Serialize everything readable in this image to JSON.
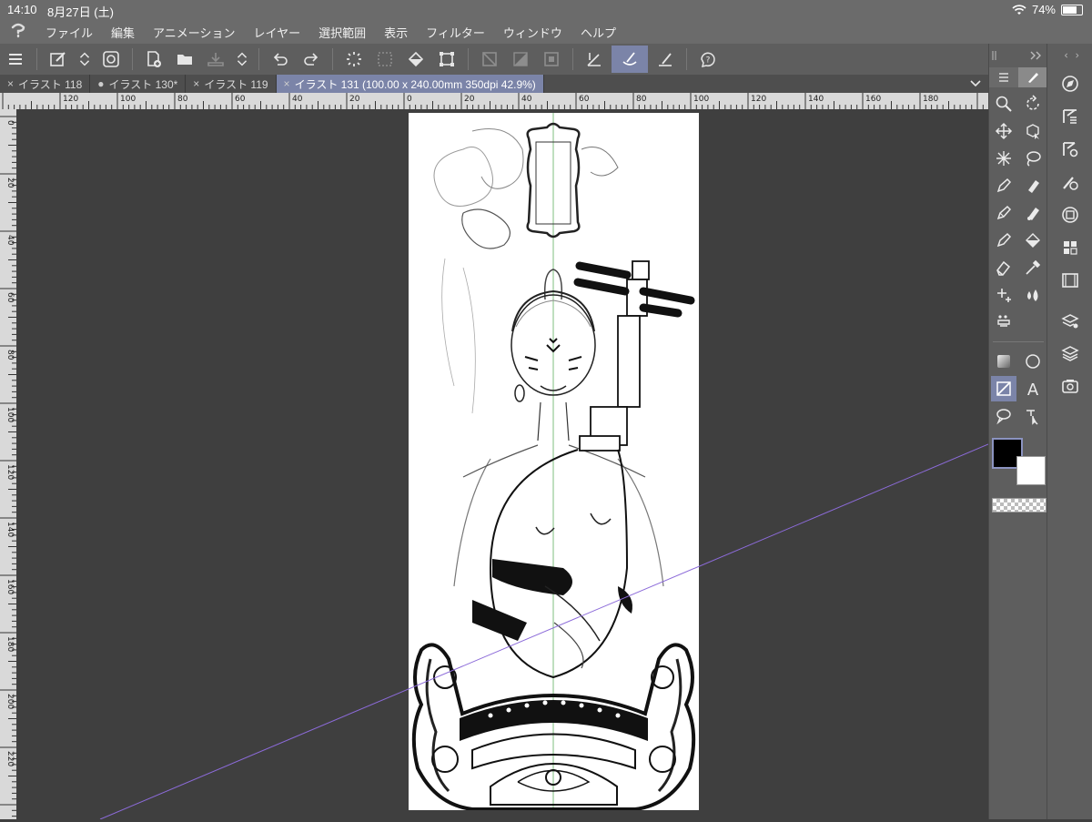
{
  "status": {
    "time": "14:10",
    "date": "8月27日 (土)",
    "battery": "74%",
    "battery_level": 0.74
  },
  "menu": [
    "ファイル",
    "編集",
    "アニメーション",
    "レイヤー",
    "選択範囲",
    "表示",
    "フィルター",
    "ウィンドウ",
    "ヘルプ"
  ],
  "tabs": [
    {
      "label": "イラスト 118",
      "marker": "×"
    },
    {
      "label": "イラスト 130*",
      "marker": "●"
    },
    {
      "label": "イラスト 119",
      "marker": "×"
    },
    {
      "label": "イラスト 131 (100.00 x 240.00mm 350dpi 42.9%)",
      "marker": "×"
    }
  ],
  "ruler_h": [
    "120",
    "100",
    "80",
    "60",
    "40",
    "20",
    "0",
    "20",
    "40",
    "60",
    "80",
    "100",
    "120",
    "140",
    "160",
    "180"
  ],
  "ruler_v": [
    "0",
    "20",
    "40",
    "60",
    "80",
    "100",
    "120",
    "140",
    "160",
    "180",
    "200",
    "220"
  ],
  "colors": {
    "main": "#000000",
    "sub": "#ffffff",
    "accent": "#7b84a8"
  }
}
